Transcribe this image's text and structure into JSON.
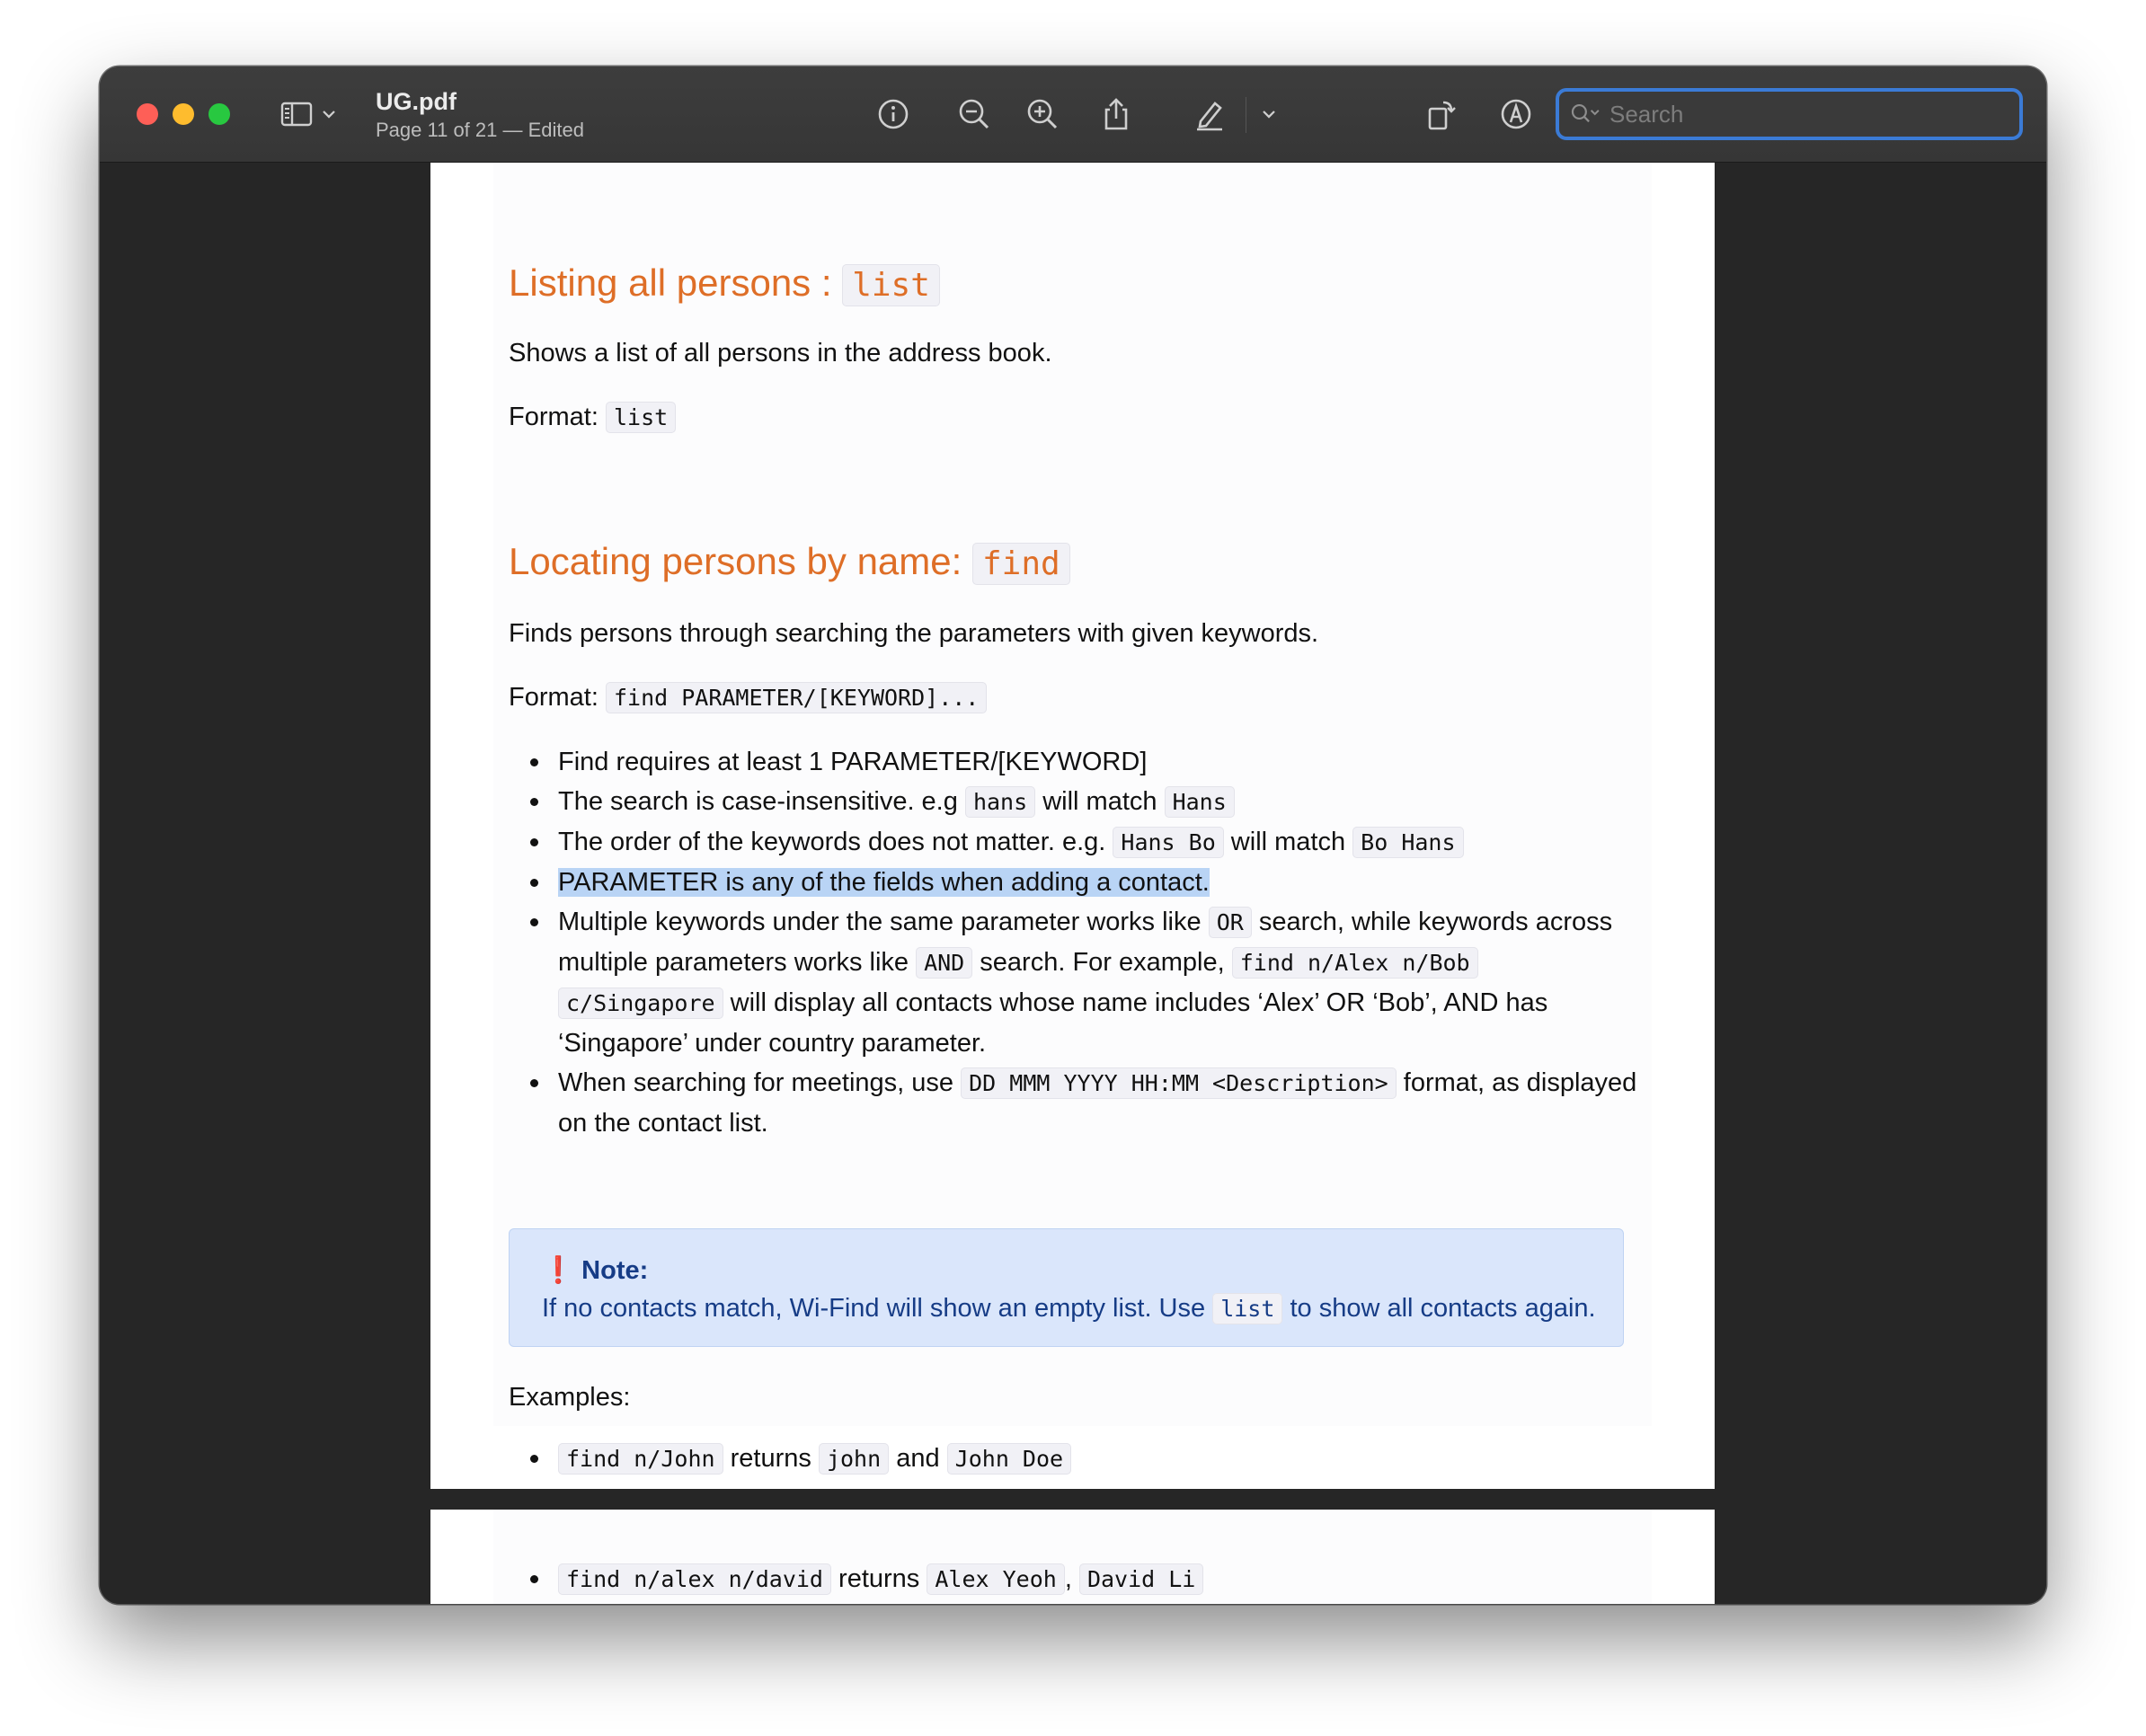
{
  "window": {
    "doc_title": "UG.pdf",
    "doc_subtitle": "Page 11 of 21 — Edited",
    "search_placeholder": "Search"
  },
  "toolbar_icons": [
    "sidebar-toggle-icon",
    "chevron-down-icon",
    "info-icon",
    "zoom-out-icon",
    "zoom-in-icon",
    "share-icon",
    "highlight-pen-icon",
    "markup-chevron-icon",
    "rotate-icon",
    "markup-icon",
    "form-fill-icon",
    "search-icon"
  ],
  "sections": {
    "list": {
      "heading": "Listing all persons : ",
      "heading_code": "list",
      "description": "Shows a list of all persons in the address book.",
      "format_label": "Format: ",
      "format_code": "list"
    },
    "find": {
      "heading": "Locating persons by name: ",
      "heading_code": "find",
      "description": "Finds persons through searching the parameters with given keywords.",
      "format_label": "Format: ",
      "format_code": "find PARAMETER/[KEYWORD]...",
      "bullets": {
        "b1": "Find requires at least 1 PARAMETER/[KEYWORD]",
        "b2_text1": "The search is case-insensitive. e.g ",
        "b2_code1": "hans",
        "b2_text2": " will match ",
        "b2_code2": "Hans",
        "b3_text1": "The order of the keywords does not matter. e.g. ",
        "b3_code1": "Hans Bo",
        "b3_text2": " will match ",
        "b3_code2": "Bo Hans",
        "b4": "PARAMETER is any of the fields when adding a contact.",
        "b5_l1_text1": "Multiple keywords under the same parameter works like ",
        "b5_l1_code1": "OR",
        "b5_l1_text2": " search, while keywords across",
        "b5_l2_text1": "multiple parameters works like ",
        "b5_l2_code1": "AND",
        "b5_l2_text2": " search. For example, ",
        "b5_l2_code2": "find n/Alex n/Bob",
        "b5_l3_code1": "c/Singapore",
        "b5_l3_text1": " will display all contacts whose name includes ‘Alex’ OR ‘Bob’, AND has",
        "b5_l4_text1": "‘Singapore’ under country parameter.",
        "b6_l1_text1": "When searching for meetings, use ",
        "b6_l1_code1": "DD MMM YYYY HH:MM <Description>",
        "b6_l1_text2": " format, as displayed",
        "b6_l2_text1": "on the contact list."
      },
      "note": {
        "icon": "❗",
        "title": "Note:",
        "text1": "If no contacts match, Wi-Find will show an empty list. Use ",
        "code": "list",
        "text2": " to show all contacts again."
      },
      "examples_label": "Examples:",
      "example1": {
        "code1": "find n/John",
        "text1": " returns ",
        "code2": "john",
        "text2": " and ",
        "code3": "John Doe"
      },
      "example2": {
        "code1": "find n/alex n/david",
        "text1": " returns ",
        "code2": "Alex Yeoh",
        "text2": ", ",
        "code3": "David Li"
      }
    }
  },
  "colors": {
    "heading": "#de6e27",
    "selection": "#b9d4f5",
    "note_bg": "#dae6fb",
    "note_text": "#163c86",
    "search_focus": "#3b7bd6"
  }
}
